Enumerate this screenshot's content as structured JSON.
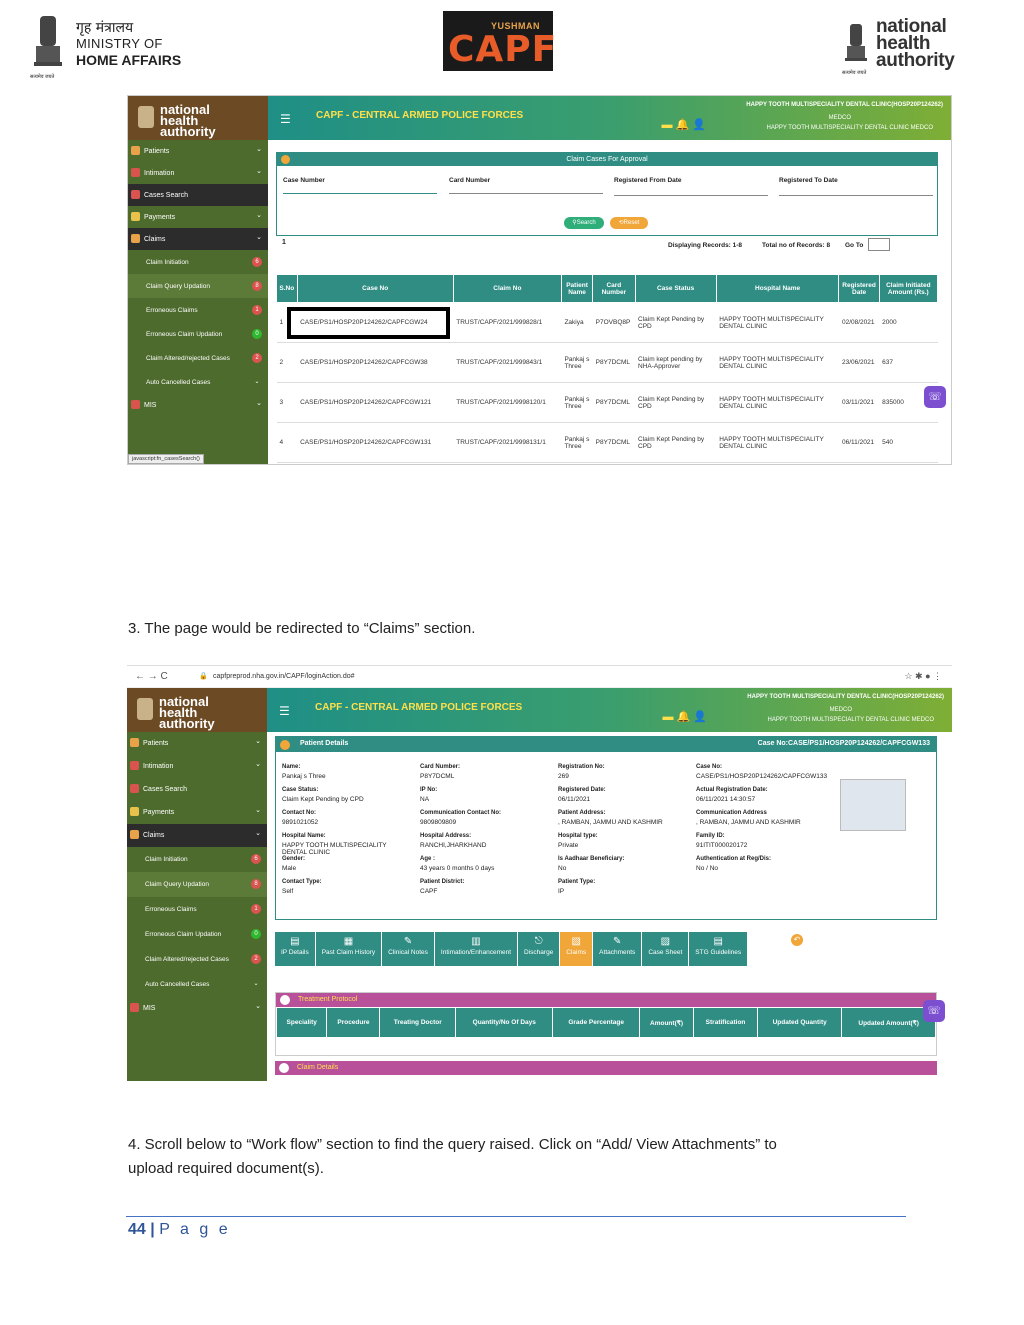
{
  "header": {
    "mha_hindi": "गृह मंत्रालय",
    "mha_line1": "MINISTRY OF",
    "mha_line2": "HOME AFFAIRS",
    "mha_motto": "सत्यमेव जयते",
    "capf_small": "YUSHMAN",
    "capf_big": "CAPF",
    "nha_text": "national health authority",
    "nha_motto": "सत्यमेव जयते"
  },
  "app": {
    "title": "CAPF - CENTRAL ARMED POLICE FORCES",
    "hospital_line": "HAPPY TOOTH MULTISPECIALITY DENTAL CLINIC(HOSP20P124262)",
    "role": "MEDCO",
    "hospital_sub": "HAPPY TOOTH MULTISPECIALITY DENTAL CLINIC MEDCO",
    "logo": "national health authority"
  },
  "sidebar1": {
    "items": [
      {
        "label": "Patients"
      },
      {
        "label": "Intimation"
      },
      {
        "label": "Cases Search"
      },
      {
        "label": "Payments"
      },
      {
        "label": "Claims"
      }
    ],
    "subs": [
      {
        "label": "Claim Initiation",
        "badge": "6",
        "color": "#d9534f"
      },
      {
        "label": "Claim Query Updation",
        "badge": "8",
        "color": "#d9534f"
      },
      {
        "label": "Erroneous Claims",
        "badge": "1",
        "color": "#d9534f"
      },
      {
        "label": "Erroneous Claim Updation",
        "badge": "0",
        "color": "#2eb82e"
      },
      {
        "label": "Claim Altered/rejected Cases",
        "badge": "2",
        "color": "#d9534f"
      },
      {
        "label": "Auto Cancelled Cases",
        "badge": "",
        "color": ""
      }
    ],
    "mis": "MIS",
    "status": "javascript:fn_casesSearch()"
  },
  "search": {
    "panel_title": "Claim Cases For Approval",
    "case_number": "Case Number",
    "card_number": "Card Number",
    "reg_from": "Registered From Date",
    "reg_to": "Registered To Date",
    "search_btn": "Search",
    "reset_btn": "Reset",
    "page": "1",
    "records": "Displaying Records: 1-8",
    "total": "Total no of Records: 8",
    "goto": "Go To"
  },
  "table": {
    "headers": [
      "S.No",
      "Case No",
      "Claim No",
      "Patient Name",
      "Card Number",
      "Case Status",
      "Hospital Name",
      "Registered Date",
      "Claim Initiated Amount (Rs.)"
    ],
    "rows": [
      [
        "1",
        "CASE/PS1/HOSP20P124262/CAPFCGW24",
        "TRUST/CAPF/2021/999828/1",
        "Zakiya",
        "P7OVBQ8P",
        "Claim Kept Pending by CPD",
        "HAPPY TOOTH MULTISPECIALITY DENTAL CLINIC",
        "02/08/2021",
        "2000"
      ],
      [
        "2",
        "CASE/PS1/HOSP20P124262/CAPFCGW38",
        "TRUST/CAPF/2021/999843/1",
        "Pankaj s Three",
        "P8Y7DCML",
        "Claim kept pending by NHA-Approver",
        "HAPPY TOOTH MULTISPECIALITY DENTAL CLINIC",
        "23/06/2021",
        "637"
      ],
      [
        "3",
        "CASE/PS1/HOSP20P124262/CAPFCGW121",
        "TRUST/CAPF/2021/9998120/1",
        "Pankaj s Three",
        "P8Y7DCML",
        "Claim Kept Pending by CPD",
        "HAPPY TOOTH MULTISPECIALITY DENTAL CLINIC",
        "03/11/2021",
        "835000"
      ],
      [
        "4",
        "CASE/PS1/HOSP20P124262/CAPFCGW131",
        "TRUST/CAPF/2021/9998131/1",
        "Pankaj s Three",
        "P8Y7DCML",
        "Claim Kept Pending by CPD",
        "HAPPY TOOTH MULTISPECIALITY DENTAL CLINIC",
        "06/11/2021",
        "540"
      ]
    ]
  },
  "step3": "3. The page would be redirected to “Claims” section.",
  "browser": {
    "url": "capfpreprod.nha.gov.in/CAPF/loginAction.do#"
  },
  "patient": {
    "panel_title": "Patient Details",
    "case_no": "Case No:CASE/PS1/HOSP20P124262/CAPFCGW133",
    "fields": [
      {
        "k": "Name:",
        "v": "Pankaj s Three"
      },
      {
        "k": "Card Number:",
        "v": "P8Y7DCML"
      },
      {
        "k": "Registration No:",
        "v": "269"
      },
      {
        "k": "Case No:",
        "v": "CASE/PS1/HOSP20P124262/CAPFCGW133"
      },
      {
        "k": "Case Status:",
        "v": "Claim Kept Pending by CPD"
      },
      {
        "k": "IP No:",
        "v": "NA"
      },
      {
        "k": "Registered Date:",
        "v": "06/11/2021"
      },
      {
        "k": "Actual Registration Date:",
        "v": "06/11/2021 14:30:57"
      },
      {
        "k": "Contact No:",
        "v": "9891021052"
      },
      {
        "k": "Communication Contact No:",
        "v": "9809809809"
      },
      {
        "k": "Patient Address:",
        "v": ", RAMBAN, JAMMU AND KASHMIR"
      },
      {
        "k": "Communication Address",
        "v": ", RAMBAN, JAMMU AND KASHMIR"
      },
      {
        "k": "Hospital Name:",
        "v": "HAPPY TOOTH MULTISPECIALITY DENTAL CLINIC"
      },
      {
        "k": "Hospital Address:",
        "v": "RANCHI,JHARKHAND"
      },
      {
        "k": "Hospital type:",
        "v": "Private"
      },
      {
        "k": "Family ID:",
        "v": "91ITIT000020172"
      },
      {
        "k": "Gender:",
        "v": "Male"
      },
      {
        "k": "Age :",
        "v": "43 years 0 months 0 days"
      },
      {
        "k": "Is Aadhaar Beneficiary:",
        "v": "No"
      },
      {
        "k": "Authentication at Reg/Dis:",
        "v": "No / No"
      },
      {
        "k": "Contact Type:",
        "v": "Self"
      },
      {
        "k": "Patient District:",
        "v": "CAPF"
      },
      {
        "k": "Patient Type:",
        "v": "IP"
      },
      {
        "k": "",
        "v": ""
      }
    ]
  },
  "tabs": [
    "IP Details",
    "Past Claim History",
    "Clinical Notes",
    "Intimation/Enhancement",
    "Discharge",
    "Claims",
    "Attachments",
    "Case Sheet",
    "STG Guidelines"
  ],
  "treatment": {
    "title": "Treatment Protocol",
    "headers": [
      "Speciality",
      "Procedure",
      "Treating Doctor",
      "Quantity/No Of Days",
      "Grade Percentage",
      "Amount(₹)",
      "Stratification",
      "Updated Quantity",
      "Updated Amount(₹)"
    ]
  },
  "claim_details": "Claim Details",
  "step4_line1": "4. Scroll below to “Work flow” section to find the query raised. Click on “Add/ View Attachments” to",
  "step4_line2": "upload required document(s).",
  "footer": {
    "page": "44",
    "sep": "|",
    "label": "P a g e"
  }
}
